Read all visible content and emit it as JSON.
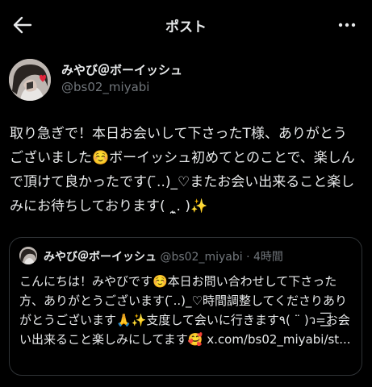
{
  "header": {
    "title": "ポスト",
    "back_icon": "back-arrow-icon",
    "more_icon": "more-options-icon"
  },
  "post": {
    "author": {
      "name": "みやび＠ボーイッシュ",
      "handle": "@bs02_miyabi"
    },
    "text": "取り急ぎで！本日お会いして下さったT様、ありがとうございました☺️ボーイッシュ初めてとのことで、楽しんで頂けて良かったです( ̄..)_♡またお会い出来ること楽しみにお待ちしております( ˛̼. )✨"
  },
  "quoted_post": {
    "author_name": "みやび＠ボーイッシュ",
    "handle": "@bs02_miyabi",
    "separator": "·",
    "time": "4時間",
    "text": "こんにちは！みやびです☺️本日お問い合わせして下さった方、ありがとうございます( ̄..)_♡時間調整してくださりありがとうございます🙏✨支度して会いに行きます٩( ¨ )ว=͟͟͞͞お会い出来ること楽しみにしてます🥰 x.com/bs02_miyabi/st..."
  }
}
